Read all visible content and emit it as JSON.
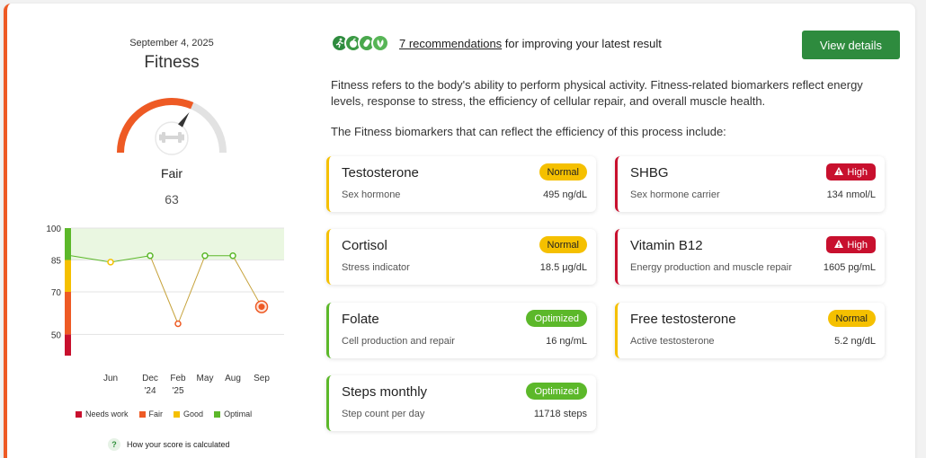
{
  "summary": {
    "date": "September 4, 2025",
    "title": "Fitness",
    "score_label": "Fair",
    "score_value": "63",
    "score_fraction": 0.63
  },
  "colors": {
    "accent": "#ee5a24",
    "needs_work": "#c8102e",
    "fair": "#ee5a24",
    "good": "#f5c000",
    "optimal": "#5cb82a",
    "button": "#2e8b3e"
  },
  "chart_data": {
    "type": "line",
    "x": [
      "",
      "Jun",
      "Dec '24",
      "Feb '25",
      "May",
      "Aug",
      "Sep"
    ],
    "y_ticks": [
      "100",
      "85",
      "70",
      "50"
    ],
    "ylim": [
      40,
      100
    ],
    "values": [
      87,
      84,
      87,
      55,
      87,
      87,
      63
    ],
    "optimal_band": [
      85,
      100
    ],
    "tick_labels": [
      {
        "line1": "Jun",
        "line2": ""
      },
      {
        "line1": "Dec",
        "line2": "'24"
      },
      {
        "line1": "Feb",
        "line2": "'25"
      },
      {
        "line1": "May",
        "line2": ""
      },
      {
        "line1": "Aug",
        "line2": ""
      },
      {
        "line1": "Sep",
        "line2": ""
      }
    ]
  },
  "legend": {
    "needs_work": "Needs work",
    "fair": "Fair",
    "good": "Good",
    "optimal": "Optimal"
  },
  "how_link": {
    "badge": "?",
    "text": "How your score is calculated"
  },
  "recommendations": {
    "link": "7 recommendations",
    "suffix": " for improving your latest result",
    "icons": [
      "activity-icon",
      "nutrition-icon",
      "supplement-icon",
      "lifestyle-icon"
    ]
  },
  "view_button": "View details",
  "description": "Fitness refers to the body's ability to perform physical activity. Fitness-related biomarkers reflect energy levels, response to stress, the efficiency of cellular repair, and overall muscle health.",
  "intro": "The Fitness biomarkers that can reflect the efficiency of this process include:",
  "biomarkers": [
    {
      "name": "Testosterone",
      "sub": "Sex hormone",
      "value": "495 ng/dL",
      "status": "Normal",
      "kind": "normal"
    },
    {
      "name": "SHBG",
      "sub": "Sex hormone carrier",
      "value": "134 nmol/L",
      "status": "High",
      "kind": "high"
    },
    {
      "name": "Cortisol",
      "sub": "Stress indicator",
      "value": "18.5 μg/dL",
      "status": "Normal",
      "kind": "normal"
    },
    {
      "name": "Vitamin B12",
      "sub": "Energy production and muscle repair",
      "value": "1605 pg/mL",
      "status": "High",
      "kind": "high"
    },
    {
      "name": "Folate",
      "sub": "Cell production and repair",
      "value": "16 ng/mL",
      "status": "Optimized",
      "kind": "optimized"
    },
    {
      "name": "Free testosterone",
      "sub": "Active testosterone",
      "value": "5.2 ng/dL",
      "status": "Normal",
      "kind": "normal"
    },
    {
      "name": "Steps monthly",
      "sub": "Step count per day",
      "value": "11718 steps",
      "status": "Optimized",
      "kind": "optimized"
    }
  ]
}
